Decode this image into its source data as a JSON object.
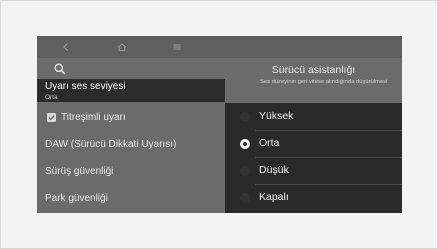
{
  "topbar": {
    "back_icon": "chevron-left-icon",
    "home_icon": "home-icon",
    "menu_icon": "hamburger-menu-icon"
  },
  "left_menu": {
    "search_icon": "search-icon",
    "items": [
      {
        "label": "Uyarı ses seviyesi",
        "sub": "Orta",
        "selected": true
      },
      {
        "label": "Titreşimli uyarı",
        "checked": true
      },
      {
        "label": "DAW (Sürücü Dikkati Uyarısı)"
      },
      {
        "label": "Sürüş güvenliği"
      },
      {
        "label": "Park güvenliği"
      }
    ]
  },
  "right_panel": {
    "title": "Sürücü asistanlığı",
    "description": "Ses düzeyinin geri vitese alındığında düşürülmesi",
    "options": [
      {
        "label": "Yüksek",
        "selected": false
      },
      {
        "label": "Orta",
        "selected": true
      },
      {
        "label": "Düşük",
        "selected": false
      },
      {
        "label": "Kapalı",
        "selected": false
      }
    ]
  },
  "colors": {
    "panel_gray": "#6b6b6b",
    "dark_panel": "#2a2a2a",
    "text_light": "#ececec"
  }
}
